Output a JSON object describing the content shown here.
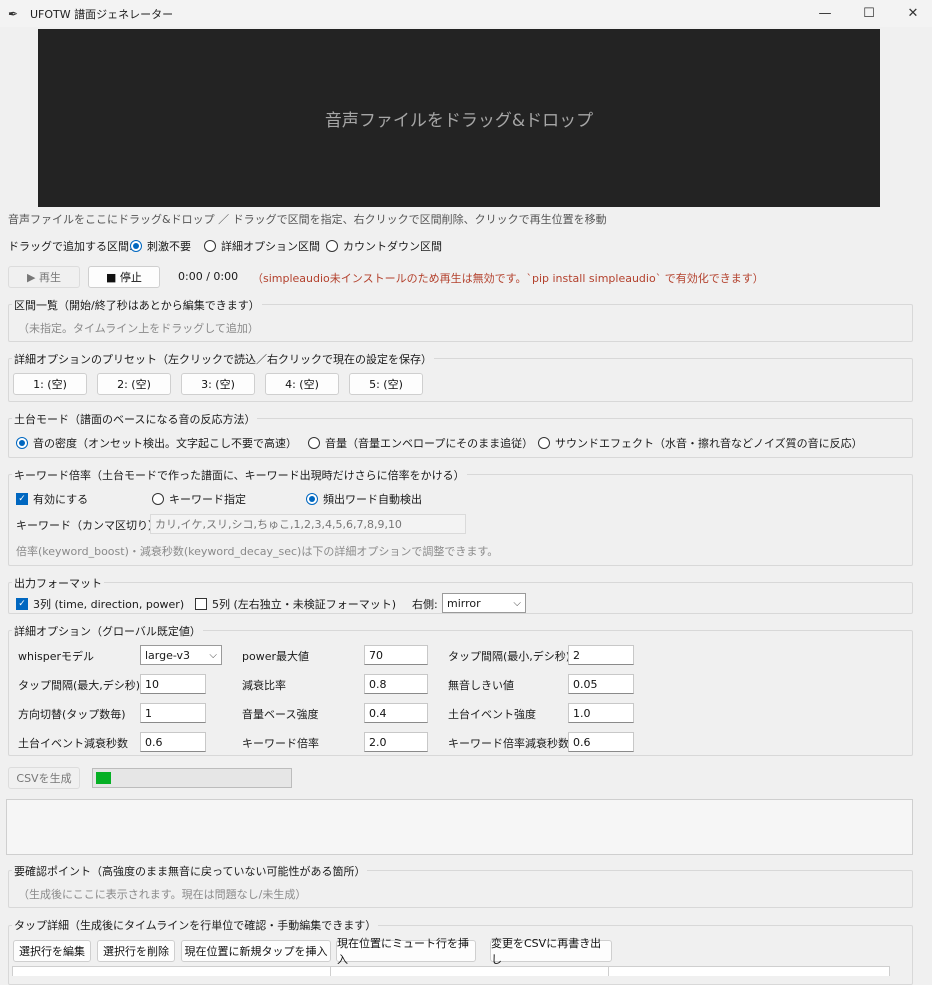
{
  "window": {
    "title": "UFOTW 譜面ジェネレーター",
    "minimize": "—",
    "maximize": "☐",
    "close": "✕"
  },
  "dropzone": {
    "text": "音声ファイルをドラッグ&ドロップ"
  },
  "hint": "音声ファイルをここにドラッグ&ドロップ ／ ドラッグで区間を指定、右クリックで区間削除、クリックで再生位置を移動",
  "drag_mode": {
    "label": "ドラッグで追加する区間:",
    "options": [
      {
        "label": "刺激不要",
        "selected": true
      },
      {
        "label": "詳細オプション区間",
        "selected": false
      },
      {
        "label": "カウントダウン区間",
        "selected": false
      }
    ]
  },
  "playback": {
    "play": "▶ 再生",
    "stop": "■ 停止",
    "time": "0:00 / 0:00",
    "warning": "（simpleaudio未インストールのため再生は無効です。`pip install simpleaudio` で有効化できます）"
  },
  "segments": {
    "title": "区間一覧（開始/終了秒はあとから編集できます）",
    "empty": "（未指定。タイムライン上をドラッグして追加）"
  },
  "presets": {
    "title": "詳細オプションのプリセット（左クリックで読込／右クリックで現在の設定を保存）",
    "buttons": [
      "1: (空)",
      "2: (空)",
      "3: (空)",
      "4: (空)",
      "5: (空)"
    ]
  },
  "base_mode": {
    "title": "土台モード（譜面のベースになる音の反応方法）",
    "options": [
      {
        "label": "音の密度（オンセット検出。文字起こし不要で高速）",
        "selected": true
      },
      {
        "label": "音量（音量エンベロープにそのまま追従）",
        "selected": false
      },
      {
        "label": "サウンドエフェクト（水音・擦れ音などノイズ質の音に反応）",
        "selected": false
      }
    ]
  },
  "keyword": {
    "title": "キーワード倍率（土台モードで作った譜面に、キーワード出現時だけさらに倍率をかける）",
    "enable": {
      "label": "有効にする",
      "checked": true
    },
    "options": [
      {
        "label": "キーワード指定",
        "selected": false
      },
      {
        "label": "頻出ワード自動検出",
        "selected": true
      }
    ],
    "field_label": "キーワード（カンマ区切り）：",
    "field_value": "カリ,イケ,スリ,シコ,ちゅこ,1,2,3,4,5,6,7,8,9,10",
    "note": "倍率(keyword_boost)・減衰秒数(keyword_decay_sec)は下の詳細オプションで調整できます。"
  },
  "output": {
    "title": "出力フォーマット",
    "three_col": {
      "label": "3列 (time, direction, power)",
      "checked": true
    },
    "five_col": {
      "label": "5列 (左右独立・未検証フォーマット)",
      "checked": false
    },
    "right_label": "右側:",
    "right_value": "mirror"
  },
  "advanced": {
    "title": "詳細オプション（グローバル既定値）",
    "rows": [
      [
        {
          "label": "whisperモデル",
          "value": "large-v3",
          "type": "select"
        },
        {
          "label": "power最大値",
          "value": "70"
        },
        {
          "label": "タップ間隔(最小,デシ秒)",
          "value": "2"
        }
      ],
      [
        {
          "label": "タップ間隔(最大,デシ秒)",
          "value": "10"
        },
        {
          "label": "減衰比率",
          "value": "0.8"
        },
        {
          "label": "無音しきい値",
          "value": "0.05"
        }
      ],
      [
        {
          "label": "方向切替(タップ数毎)",
          "value": "1"
        },
        {
          "label": "音量ベース強度",
          "value": "0.4"
        },
        {
          "label": "土台イベント強度",
          "value": "1.0"
        }
      ],
      [
        {
          "label": "土台イベント減衰秒数",
          "value": "0.6"
        },
        {
          "label": "キーワード倍率",
          "value": "2.0"
        },
        {
          "label": "キーワード倍率減衰秒数",
          "value": "0.6"
        }
      ]
    ]
  },
  "generate": {
    "label": "CSVを生成",
    "progress": 0.08
  },
  "review": {
    "title": "要確認ポイント（高強度のまま無音に戻っていない可能性がある箇所）",
    "text": "（生成後にここに表示されます。現在は問題なし/未生成）"
  },
  "taps": {
    "title": "タップ詳細（生成後にタイムラインを行単位で確認・手動編集できます）",
    "buttons": [
      "選択行を編集",
      "選択行を削除",
      "現在位置に新規タップを挿入",
      "現在位置にミュート行を挿入",
      "変更をCSVに再書き出し"
    ]
  },
  "colors": {
    "accent": "#0067c0",
    "progress": "#06b025",
    "warning": "#b3412d",
    "dropzone": "#232323"
  }
}
